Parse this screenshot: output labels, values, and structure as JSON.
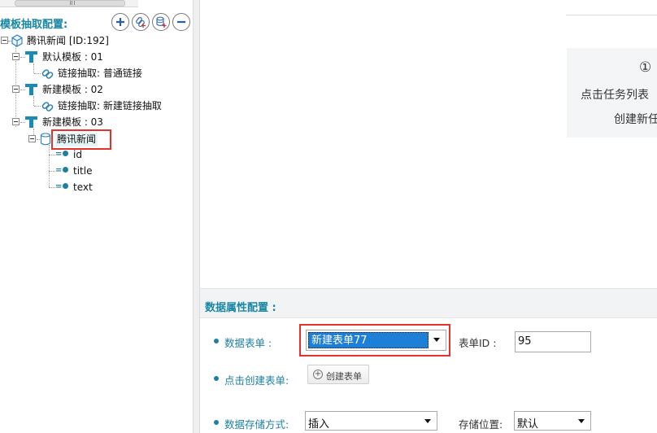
{
  "tree": {
    "title": "模板抽取配置:",
    "toolbar": {
      "add_icon": "plus-icon",
      "link_icon": "add-link-icon",
      "db_icon": "add-database-icon",
      "remove_icon": "minus-icon"
    },
    "root": {
      "label": "腾讯新闻 [ID:192]",
      "icon": "cube-icon"
    },
    "templates": [
      {
        "label": "默认模板 : 01",
        "link_label": "链接抽取: 普通链接"
      },
      {
        "label": "新建模板 : 02",
        "link_label": "链接抽取: 新建链接抽取"
      },
      {
        "label": "新建模板 : 03"
      }
    ],
    "selected_node": "腾讯新闻",
    "fields": [
      "id",
      "title",
      "text"
    ]
  },
  "info": {
    "number": "①",
    "line1": "点击任务列表",
    "line2": "创建新任"
  },
  "config": {
    "title": "数据属性配置 :",
    "form_label": "数据表单 :",
    "form_value": "新建表单77",
    "form_id_label": "表单ID :",
    "form_id_value": "95",
    "create_label": "点击创建表单:",
    "create_button": "创建表单",
    "storage_label": "数据存储方式:",
    "storage_value": "插入",
    "position_label": "存储位置:",
    "position_value": "默认"
  },
  "colors": {
    "accent": "#1787a6",
    "highlight_border": "#e5322d",
    "selection": "#1e7fd6"
  }
}
